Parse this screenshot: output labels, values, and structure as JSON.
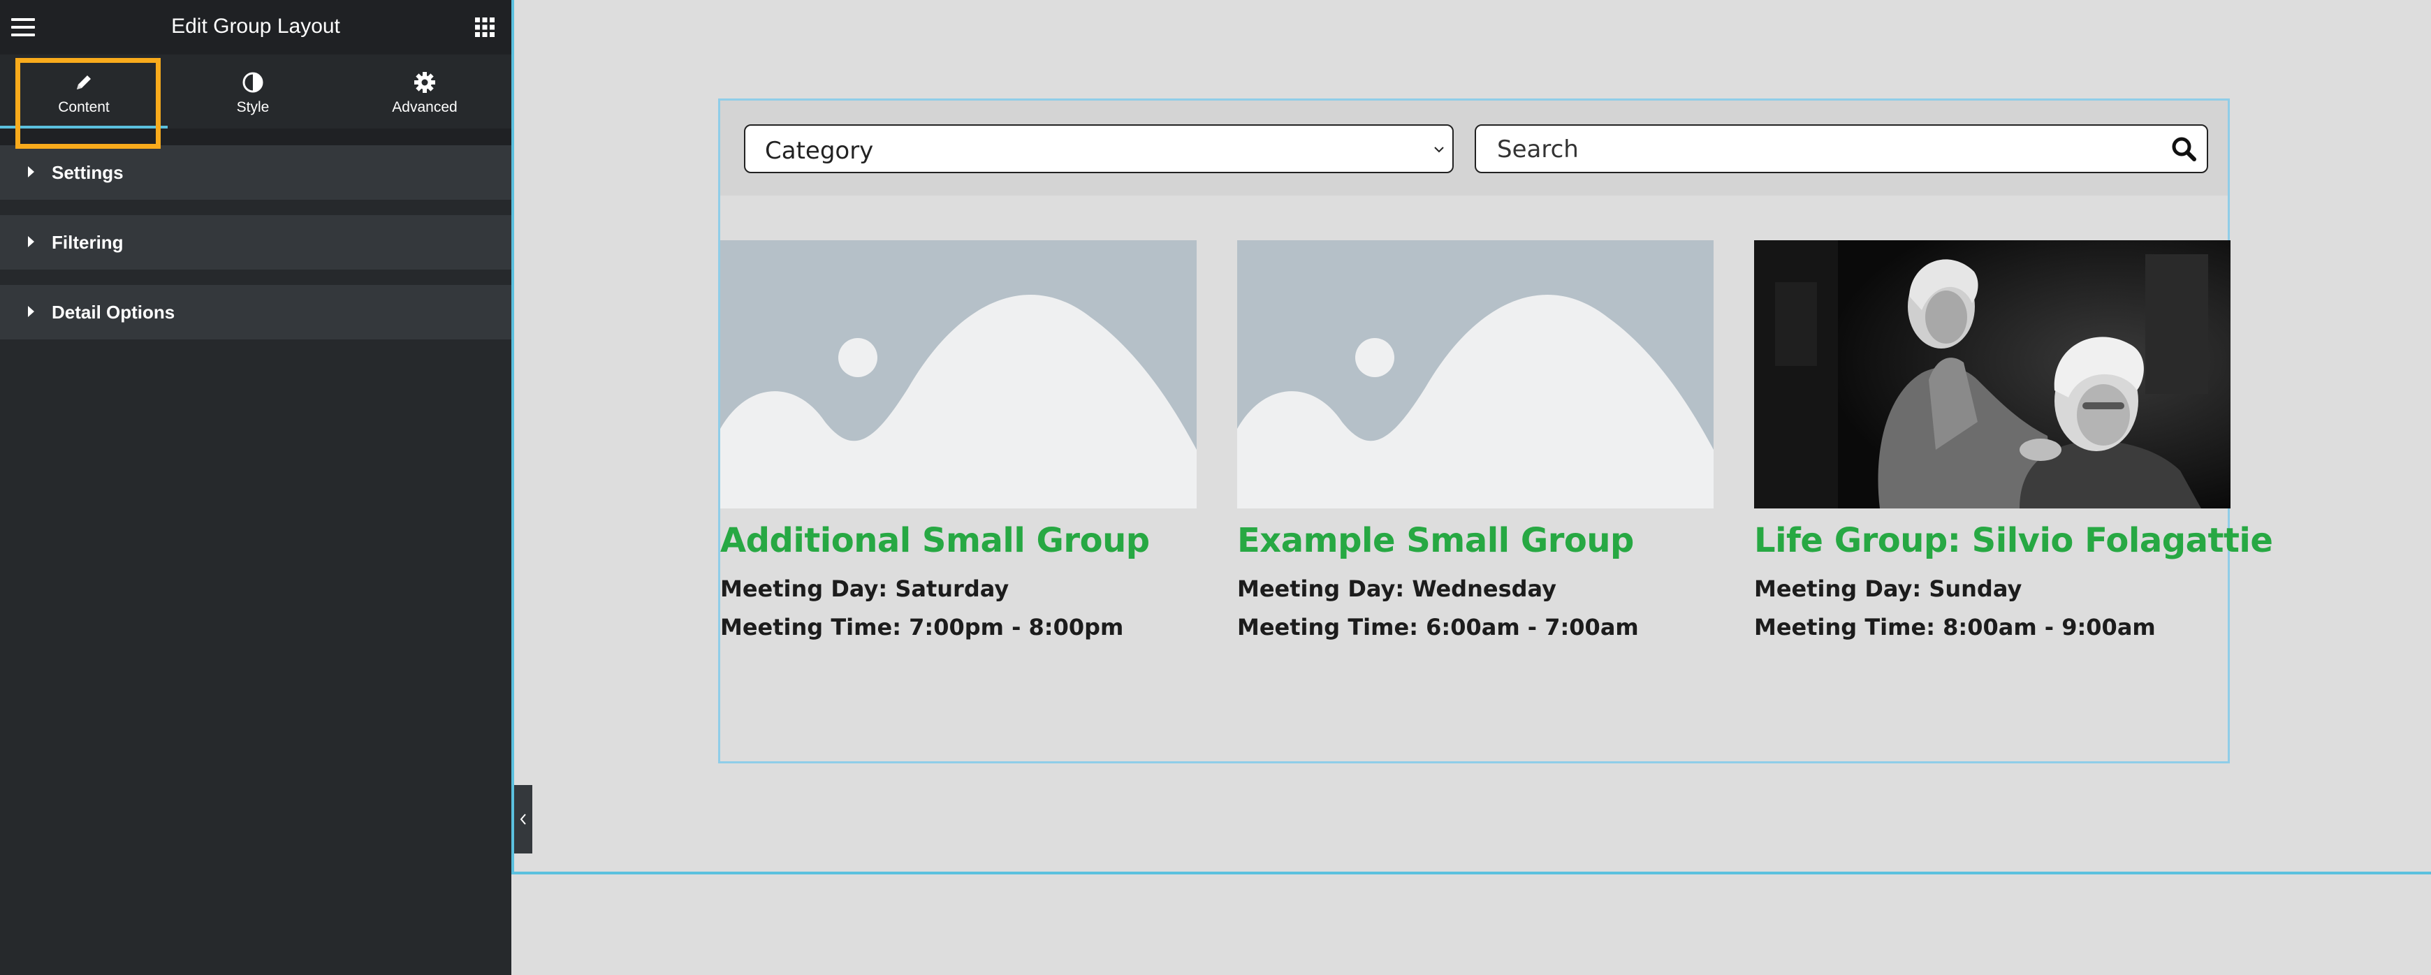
{
  "sidebar": {
    "title": "Edit Group Layout",
    "tabs": [
      {
        "label": "Content",
        "icon": "pencil-icon"
      },
      {
        "label": "Style",
        "icon": "contrast-icon"
      },
      {
        "label": "Advanced",
        "icon": "gear-icon"
      }
    ],
    "active_tab": "Content",
    "sections": [
      {
        "label": "Settings"
      },
      {
        "label": "Filtering"
      },
      {
        "label": "Detail Options"
      }
    ]
  },
  "filters": {
    "category_value": "Category",
    "search_placeholder": "Search"
  },
  "groups": [
    {
      "title": "Additional Small Group",
      "day": "Meeting Day: Saturday",
      "time": "Meeting Time: 7:00pm - 8:00pm",
      "image": "placeholder"
    },
    {
      "title": "Example Small Group",
      "day": "Meeting Day: Wednesday",
      "time": "Meeting Time: 6:00am - 7:00am",
      "image": "placeholder"
    },
    {
      "title": "Life Group: Silvio Folagattie",
      "day": "Meeting Day: Sunday",
      "time": "Meeting Time: 8:00am - 9:00am",
      "image": "photo"
    }
  ],
  "colors": {
    "accent_blue": "#5bc0de",
    "highlight_orange": "#f9ab1c",
    "title_green": "#27a843",
    "sidebar_bg": "#26292c"
  }
}
